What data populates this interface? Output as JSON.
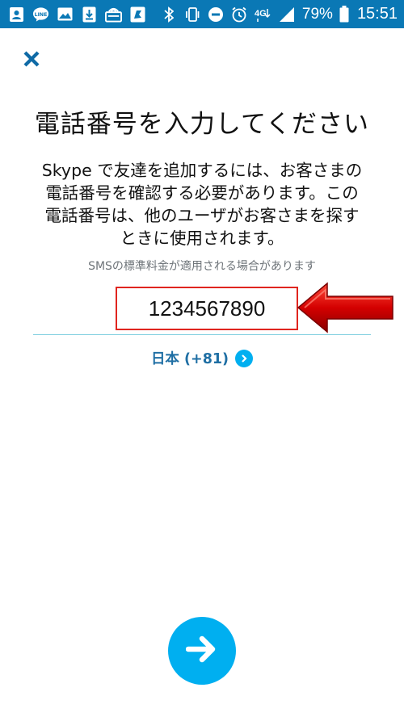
{
  "status_bar": {
    "battery_percent": "79%",
    "time": "15:51",
    "network_label": "4G",
    "left_icons": [
      "contact-card-icon",
      "line-app-icon",
      "image-icon",
      "download-icon",
      "cast-icon",
      "flag-icon"
    ],
    "right_icons": [
      "bluetooth-icon",
      "vibrate-icon",
      "do-not-disturb-icon",
      "alarm-icon",
      "signal-icon",
      "battery-icon"
    ],
    "background": "#0a78b5"
  },
  "page": {
    "close_icon": "close-icon",
    "title": "電話番号を入力してください",
    "description": "Skype で友達を追加するには、お客さまの\n電話番号を確認する必要があります。この\n電話番号は、他のユーザがお客さまを探す\nときに使用されます。",
    "sms_note": "SMSの標準料金が適用される場合があります",
    "phone_number": "1234567890",
    "country_label": "日本 (+81)",
    "next_icon": "arrow-right-icon"
  },
  "colors": {
    "accent": "#00aff0",
    "link": "#1f6fa4",
    "highlight_box": "#e0251f",
    "annotation_arrow": "#d40000"
  }
}
